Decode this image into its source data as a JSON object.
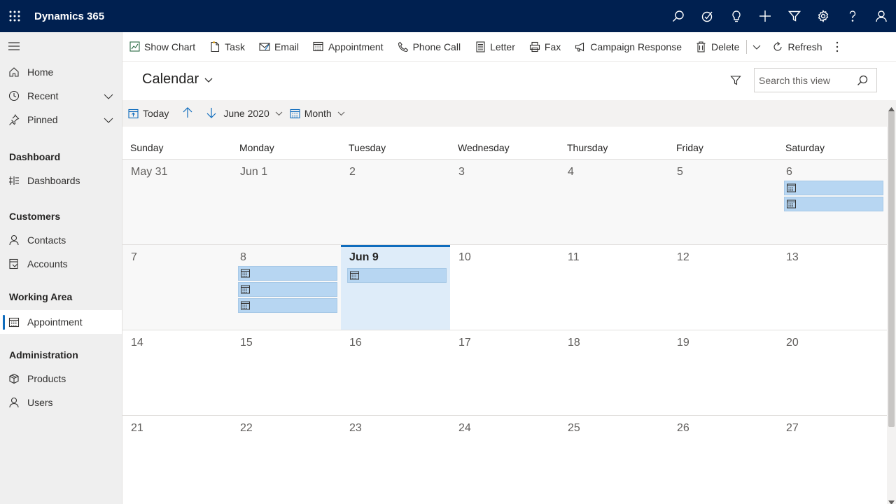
{
  "app": {
    "title": "Dynamics 365"
  },
  "topbar_icons": [
    "search-icon",
    "task-flow-icon",
    "lightbulb-icon",
    "plus-icon",
    "filter-icon",
    "gear-icon",
    "help-icon",
    "user-icon"
  ],
  "sidebar": {
    "top_items": [
      {
        "label": "Home",
        "icon": "home-icon"
      },
      {
        "label": "Recent",
        "icon": "clock-icon",
        "expandable": true
      },
      {
        "label": "Pinned",
        "icon": "pin-icon",
        "expandable": true
      }
    ],
    "sections": [
      {
        "title": "Dashboard",
        "items": [
          {
            "label": "Dashboards",
            "icon": "dashboard-icon"
          }
        ]
      },
      {
        "title": "Customers",
        "items": [
          {
            "label": "Contacts",
            "icon": "person-icon"
          },
          {
            "label": "Accounts",
            "icon": "account-icon"
          }
        ]
      },
      {
        "title": "Working Area",
        "items": [
          {
            "label": "Appointment",
            "icon": "calendar-icon",
            "selected": true
          }
        ]
      },
      {
        "title": "Administration",
        "items": [
          {
            "label": "Products",
            "icon": "box-icon"
          },
          {
            "label": "Users",
            "icon": "person-icon"
          }
        ]
      }
    ]
  },
  "command_bar": {
    "show_chart": "Show Chart",
    "task": "Task",
    "email": "Email",
    "appointment": "Appointment",
    "phone_call": "Phone Call",
    "letter": "Letter",
    "fax": "Fax",
    "campaign_response": "Campaign Response",
    "delete": "Delete",
    "refresh": "Refresh"
  },
  "view": {
    "title": "Calendar",
    "search_placeholder": "Search this view"
  },
  "calendar_toolbar": {
    "today": "Today",
    "month_label": "June 2020",
    "view_mode": "Month"
  },
  "calendar": {
    "days_of_week": [
      "Sunday",
      "Monday",
      "Tuesday",
      "Wednesday",
      "Thursday",
      "Friday",
      "Saturday"
    ],
    "weeks": [
      [
        {
          "label": "May 31",
          "events": 0,
          "other": true
        },
        {
          "label": "Jun 1",
          "events": 0
        },
        {
          "label": "2",
          "events": 0
        },
        {
          "label": "3",
          "events": 0
        },
        {
          "label": "4",
          "events": 0
        },
        {
          "label": "5",
          "events": 0
        },
        {
          "label": "6",
          "events": 2
        }
      ],
      [
        {
          "label": "7",
          "events": 0
        },
        {
          "label": "8",
          "events": 3
        },
        {
          "label": "Jun 9",
          "events": 1,
          "today": true
        },
        {
          "label": "10",
          "events": 0
        },
        {
          "label": "11",
          "events": 0
        },
        {
          "label": "12",
          "events": 0
        },
        {
          "label": "13",
          "events": 0
        }
      ],
      [
        {
          "label": "14",
          "events": 0
        },
        {
          "label": "15",
          "events": 0
        },
        {
          "label": "16",
          "events": 0
        },
        {
          "label": "17",
          "events": 0
        },
        {
          "label": "18",
          "events": 0
        },
        {
          "label": "19",
          "events": 0
        },
        {
          "label": "20",
          "events": 0
        }
      ],
      [
        {
          "label": "21",
          "events": 0
        },
        {
          "label": "22",
          "events": 0
        },
        {
          "label": "23",
          "events": 0
        },
        {
          "label": "24",
          "events": 0
        },
        {
          "label": "25",
          "events": 0
        },
        {
          "label": "26",
          "events": 0
        },
        {
          "label": "27",
          "events": 0
        }
      ]
    ]
  },
  "colors": {
    "topbar": "#002050",
    "accent": "#0f6cbd",
    "event_fill": "#b7d6f2",
    "today_fill": "#deecf9"
  }
}
